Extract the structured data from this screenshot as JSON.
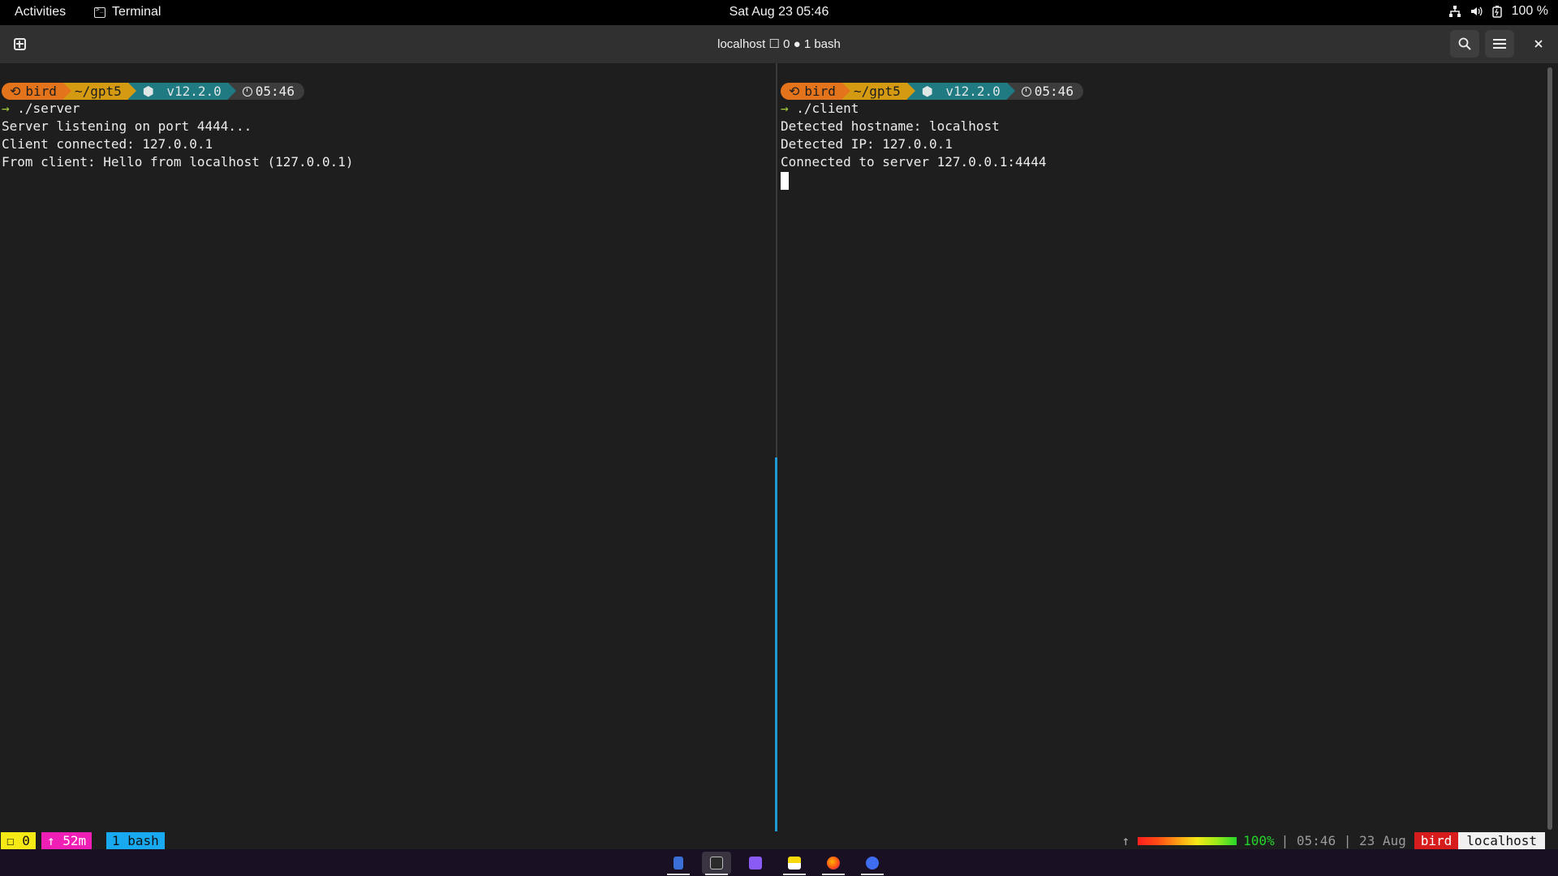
{
  "topbar": {
    "activities": "Activities",
    "app_name": "Terminal",
    "clock": "Sat Aug 23  05:46",
    "battery": "100 %"
  },
  "headerbar": {
    "title": "localhost ☐ 0 ● 1 bash"
  },
  "prompt": {
    "user": "bird",
    "dir": "~/gpt5",
    "node": "v12.2.0",
    "time": "05:46"
  },
  "left_pane": {
    "command": "./server",
    "output": [
      "Server listening on port 4444...",
      "Client connected: 127.0.0.1",
      "From client: Hello from localhost (127.0.0.1)"
    ]
  },
  "right_pane": {
    "command": "./client",
    "output": [
      "Detected hostname: localhost",
      "Detected IP: 127.0.0.1",
      "Connected to server 127.0.0.1:4444"
    ]
  },
  "tmux": {
    "session": "☐ 0",
    "uptime": "↑ 52m",
    "window": "1 bash",
    "up_arrow": "↑",
    "battery_pct": "100%",
    "meta": "| 05:46 | 23 Aug",
    "user": "bird",
    "host": "localhost"
  },
  "dock": {
    "items": [
      "text-editor-icon",
      "terminal-icon",
      "task-app-icon",
      "notes-icon",
      "firefox-icon",
      "chat-app-icon"
    ]
  },
  "colors": {
    "accent_divider": "#1e9ad6",
    "prompt_user": "#e4741b",
    "prompt_dir": "#d49a11",
    "prompt_node": "#1f7a82"
  }
}
